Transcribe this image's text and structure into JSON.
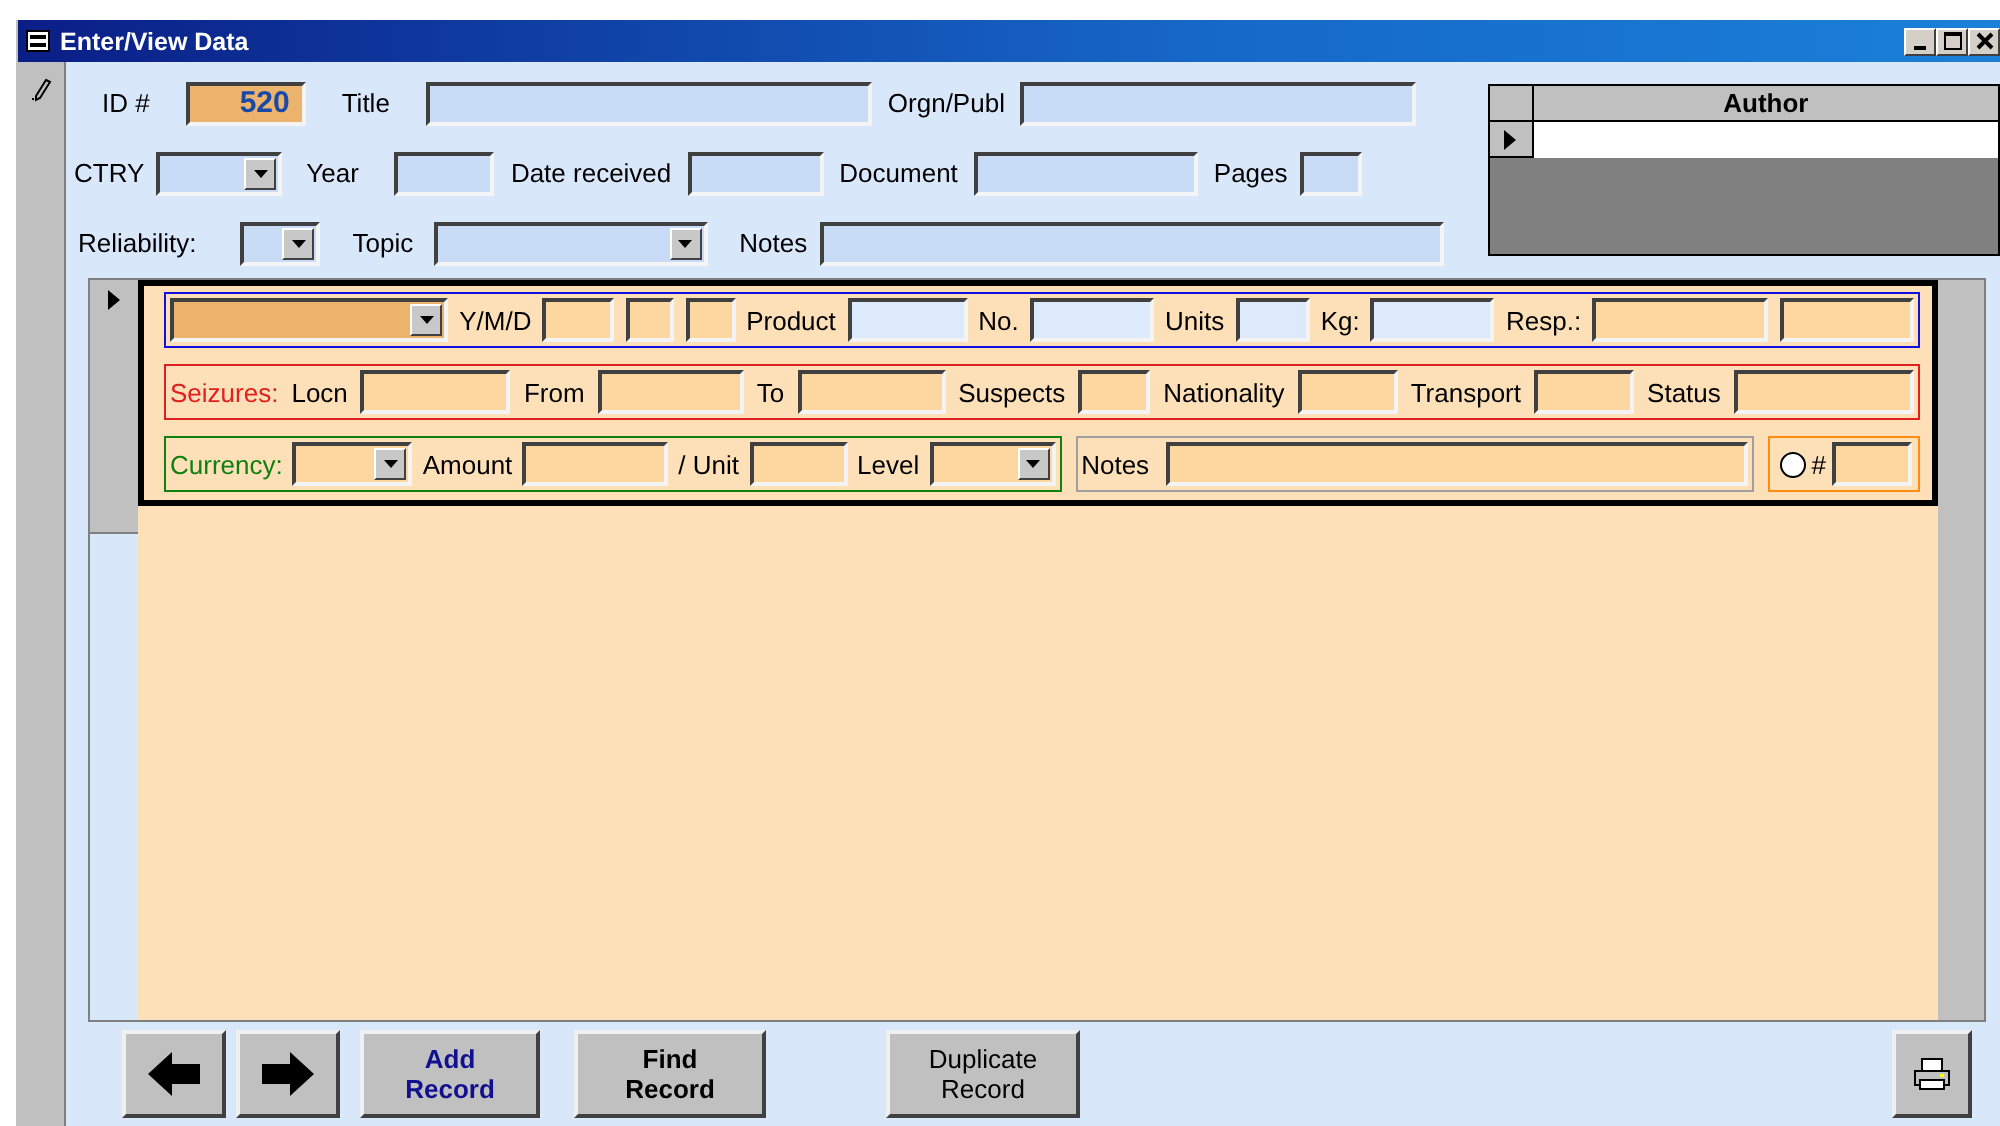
{
  "window": {
    "title": "Enter/View Data"
  },
  "header": {
    "rows": [
      {
        "items": [
          {
            "kind": "label",
            "text": "ID #"
          },
          {
            "kind": "field",
            "value": "520",
            "color": "#ecb36c"
          },
          {
            "kind": "label",
            "text": "Title"
          },
          {
            "kind": "field"
          },
          {
            "kind": "label",
            "text": "Orgn/Publ"
          },
          {
            "kind": "field"
          }
        ]
      },
      {
        "items": [
          {
            "kind": "label",
            "text": "CTRY"
          },
          {
            "kind": "combo"
          },
          {
            "kind": "label",
            "text": "Year"
          },
          {
            "kind": "field"
          },
          {
            "kind": "label",
            "text": "Date received"
          },
          {
            "kind": "field"
          },
          {
            "kind": "label",
            "text": "Document"
          },
          {
            "kind": "field"
          },
          {
            "kind": "label",
            "text": "Pages"
          },
          {
            "kind": "field"
          }
        ]
      },
      {
        "items": [
          {
            "kind": "label",
            "text": "Reliability:"
          },
          {
            "kind": "combo"
          },
          {
            "kind": "label",
            "text": "Topic"
          },
          {
            "kind": "combo"
          },
          {
            "kind": "label",
            "text": "Notes"
          },
          {
            "kind": "field"
          }
        ]
      }
    ]
  },
  "author_grid": {
    "column": "Author"
  },
  "detail": {
    "lines": [
      {
        "boxes": [
          {
            "color": "#1010e0",
            "items": [
              {
                "kind": "combo",
                "color": "#ecb36c"
              },
              {
                "kind": "label",
                "text": "Y/M/D"
              },
              {
                "kind": "field"
              },
              {
                "kind": "field"
              },
              {
                "kind": "field"
              },
              {
                "kind": "label",
                "text": "Product"
              },
              {
                "kind": "field",
                "color": "#dceafc"
              },
              {
                "kind": "label",
                "text": "No."
              },
              {
                "kind": "field",
                "color": "#dceafc"
              },
              {
                "kind": "label",
                "text": "Units"
              },
              {
                "kind": "field",
                "color": "#dceafc"
              },
              {
                "kind": "label",
                "text": "Kg:"
              },
              {
                "kind": "field",
                "color": "#dceafc"
              },
              {
                "kind": "label",
                "text": "Resp.:"
              },
              {
                "kind": "field"
              },
              {
                "kind": "field"
              }
            ]
          }
        ]
      },
      {
        "boxes": [
          {
            "color": "#e02020",
            "items": [
              {
                "kind": "caption",
                "text": "Seizures:"
              },
              {
                "kind": "label",
                "text": "Locn"
              },
              {
                "kind": "field"
              },
              {
                "kind": "label",
                "text": "From"
              },
              {
                "kind": "field"
              },
              {
                "kind": "label",
                "text": "To"
              },
              {
                "kind": "field"
              },
              {
                "kind": "label",
                "text": "Suspects"
              },
              {
                "kind": "field"
              },
              {
                "kind": "label",
                "text": "Nationality"
              },
              {
                "kind": "field"
              },
              {
                "kind": "label",
                "text": "Transport"
              },
              {
                "kind": "field"
              },
              {
                "kind": "label",
                "text": "Status"
              },
              {
                "kind": "field"
              }
            ]
          }
        ]
      },
      {
        "boxes": [
          {
            "color": "#108010",
            "items": [
              {
                "kind": "caption",
                "text": "Currency:"
              },
              {
                "kind": "combo"
              },
              {
                "kind": "label",
                "text": "Amount"
              },
              {
                "kind": "field"
              },
              {
                "kind": "label",
                "text": "/ Unit"
              },
              {
                "kind": "field"
              },
              {
                "kind": "label",
                "text": "Level"
              },
              {
                "kind": "combo"
              }
            ]
          },
          {
            "color": "#a0a0a0",
            "items": [
              {
                "kind": "label",
                "text": "Notes"
              },
              {
                "kind": "field"
              }
            ]
          },
          {
            "color": "#ff8c10",
            "items": [
              {
                "kind": "radio",
                "selected": false
              },
              {
                "kind": "label",
                "text": "#"
              },
              {
                "kind": "field"
              }
            ]
          }
        ]
      }
    ]
  },
  "buttons": [
    {
      "kind": "back"
    },
    {
      "kind": "forward"
    },
    {
      "kind": "accent",
      "label": "Add Record"
    },
    {
      "kind": "bold",
      "label": "Find Record"
    },
    {
      "kind": "plain",
      "label": "Duplicate Record"
    },
    {
      "kind": "print"
    }
  ]
}
